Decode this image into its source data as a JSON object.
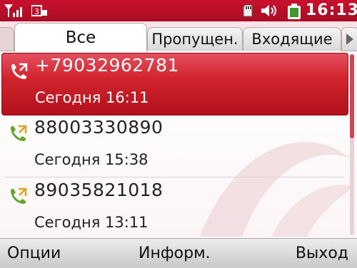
{
  "status_bar": {
    "time": "16:13",
    "icons": [
      "signal-icon",
      "network-3g-icon",
      "memory-card-icon",
      "speaker-icon",
      "battery-icon"
    ]
  },
  "tabs": [
    {
      "label": "Все",
      "active": true
    },
    {
      "label": "Пропущен.",
      "active": false
    },
    {
      "label": "Входящие",
      "active": false
    }
  ],
  "calls": [
    {
      "number": "+79032962781",
      "time": "Сегодня 16:11",
      "selected": true,
      "icon": "outgoing-call-icon"
    },
    {
      "number": "88003330890",
      "time": "Сегодня 15:38",
      "selected": false,
      "icon": "outgoing-call-icon"
    },
    {
      "number": "89035821018",
      "time": "Сегодня 13:11",
      "selected": false,
      "icon": "outgoing-call-icon"
    }
  ],
  "softkeys": {
    "left": "Опции",
    "middle": "Информ.",
    "right": "Выход"
  },
  "colors": {
    "accent": "#c8102e",
    "selected_row": "#d2252e",
    "call_icon": "#5fa52e"
  }
}
